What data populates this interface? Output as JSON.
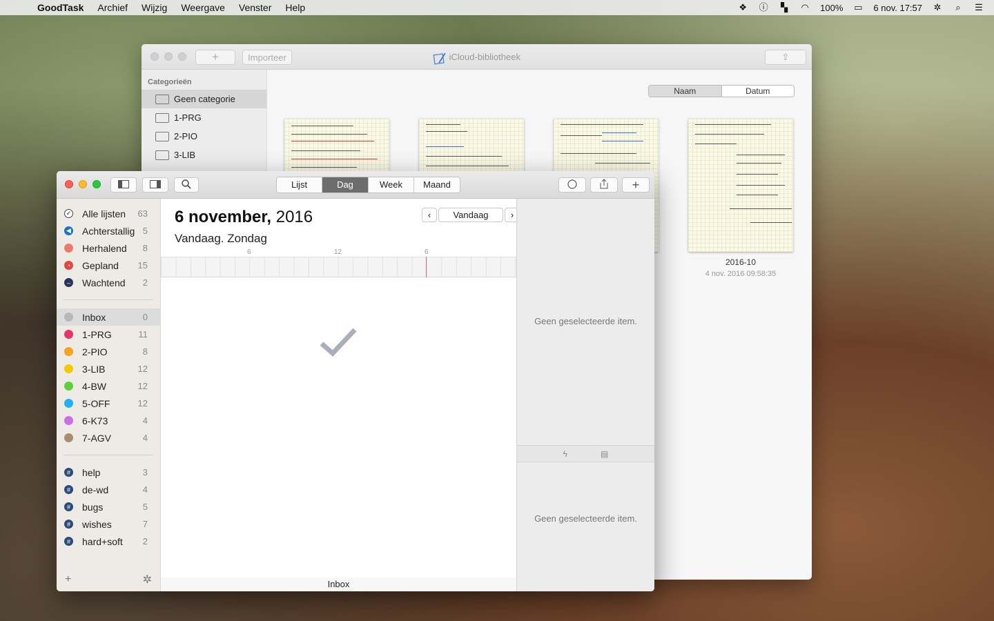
{
  "menubar": {
    "app": "GoodTask",
    "items": [
      "Archief",
      "Wijzig",
      "Weergave",
      "Venster",
      "Help"
    ],
    "battery": "100%",
    "clock": "6 nov.  17:57"
  },
  "library": {
    "title": "iCloud-bibliotheek",
    "import_label": "Importeer",
    "add_label": "+",
    "sidebar_header": "Categorieën",
    "categories": [
      "Geen categorie",
      "1-PRG",
      "2-PIO",
      "3-LIB"
    ],
    "sort": {
      "name": "Naam",
      "date": "Datum"
    },
    "notebook": {
      "name": "2016-10",
      "date": "4 nov. 2016 09:58:35"
    }
  },
  "goodtask": {
    "views": [
      "Lijst",
      "Dag",
      "Week",
      "Maand"
    ],
    "smart_lists": [
      {
        "label": "Alle lijsten",
        "count": "63",
        "color": "#ffffff",
        "glyph": "✓"
      },
      {
        "label": "Achterstallig",
        "count": "5",
        "color": "#1a73c8",
        "glyph": "◀"
      },
      {
        "label": "Herhalend",
        "count": "8",
        "color": "#f07a6a",
        "glyph": ""
      },
      {
        "label": "Gepland",
        "count": "15",
        "color": "#e0493f",
        "glyph": "◔"
      },
      {
        "label": "Wachtend",
        "count": "2",
        "color": "#26365c",
        "glyph": "–"
      }
    ],
    "lists": [
      {
        "label": "Inbox",
        "count": "0",
        "color": "#b8b8b8"
      },
      {
        "label": "1-PRG",
        "count": "11",
        "color": "#e8336a"
      },
      {
        "label": "2-PIO",
        "count": "8",
        "color": "#f7a21d"
      },
      {
        "label": "3-LIB",
        "count": "12",
        "color": "#f5c900"
      },
      {
        "label": "4-BW",
        "count": "12",
        "color": "#5fcf3c"
      },
      {
        "label": "5-OFF",
        "count": "12",
        "color": "#1fb2ef"
      },
      {
        "label": "6-K73",
        "count": "4",
        "color": "#cb6ee0"
      },
      {
        "label": "7-AGV",
        "count": "4",
        "color": "#a88c6c"
      }
    ],
    "tags": [
      {
        "label": "help",
        "count": "3"
      },
      {
        "label": "de-wd",
        "count": "4"
      },
      {
        "label": "bugs",
        "count": "5"
      },
      {
        "label": "wishes",
        "count": "7"
      },
      {
        "label": "hard+soft",
        "count": "2"
      }
    ],
    "date_bold": "6 november,",
    "date_year": " 2016",
    "date_sub": "Vandaag. Zondag",
    "today_label": "Vandaag",
    "ticks": [
      "6",
      "12",
      "6"
    ],
    "footer_list": "Inbox",
    "no_item": "Geen geselecteerde item.",
    "tag_color": "#2c4a7a"
  }
}
